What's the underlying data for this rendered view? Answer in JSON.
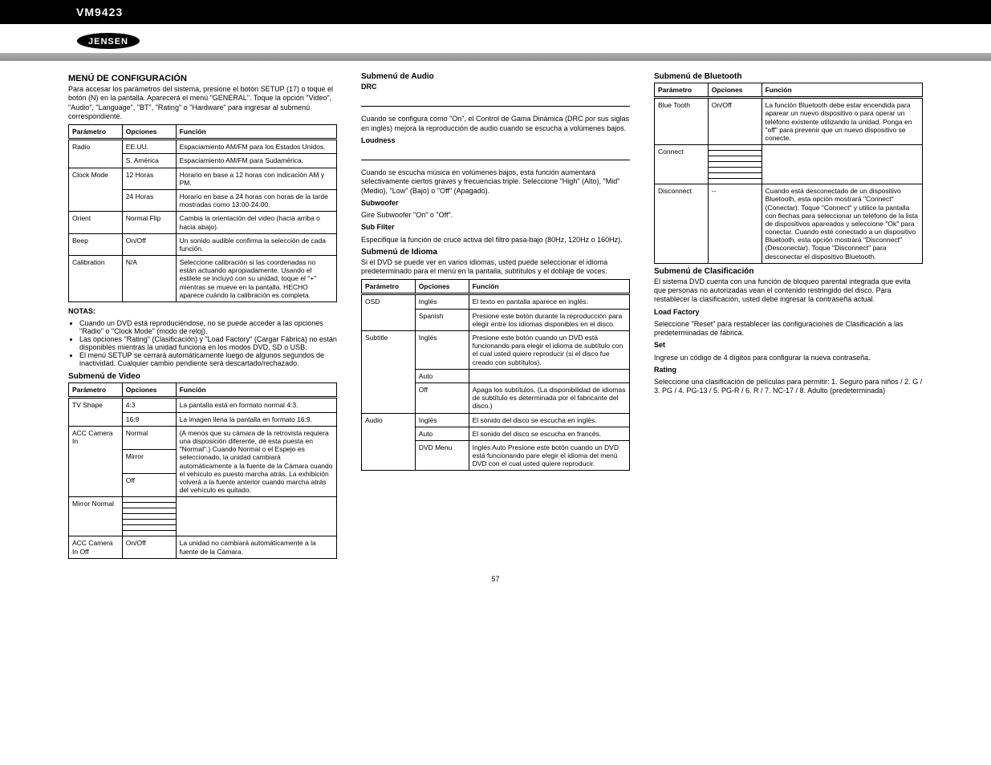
{
  "header": {
    "model": "VM9423",
    "brand": "JENSEN"
  },
  "col1": {
    "title": "MENÚ DE CONFIGURACIÓN",
    "intro": "Para accesar los parámetros del sistema, presione el botón SETUP (17) o toque el botón (N) en la pantalla. Aparecerá el menú \"GENERAL\". Toque la opción \"Video\", \"Audio\", \"Language\", \"BT\", \"Rating\" o \"Hardware\" para ingresar al submenú correspondiente.",
    "t1": {
      "h": [
        "Parámetro",
        "Opciones",
        "Función"
      ],
      "rows": [
        {
          "a": "Radio",
          "sub": [
            {
              "b": "EE.UU.",
              "c": "Espaciamiento AM/FM para los Estados Unidos."
            },
            {
              "b": "S. América",
              "c": "Espaciamiento AM/FM para Sudamérica."
            }
          ]
        },
        {
          "a": "Clock Mode",
          "sub": [
            {
              "b": "12 Horas",
              "c": "Horario en base a 12 horas con indicación AM y PM."
            },
            {
              "b": "24 Horas",
              "c": "Horario en base a 24 horas con horas de la tarde mostradas como 13:00-24:00."
            }
          ]
        },
        {
          "a": "Orient",
          "sub": [
            {
              "b": "Normal Flip",
              "c": "Cambia la orientación del video (hacia arriba o hacia abajo)."
            }
          ]
        },
        {
          "a": "Beep",
          "sub": [
            {
              "b": "On/Off",
              "c": "Un sonido audible confirma la selección de cada función."
            }
          ]
        },
        {
          "a": "Calibration",
          "sub": [
            {
              "b": "N/A",
              "c": "Seleccione calibración si las coordenadas no están actuando apropiadamente. Usando el estilete se incluyó con su unidad, toque el \"+\" mientras se mueve en la pantalla. HECHO aparece cuándo la calibración es completa."
            }
          ]
        }
      ]
    },
    "notes_title": "NOTAS:",
    "notes": [
      "Cuando un DVD está reproduciéndose, no se puede acceder a las opciones \"Radio\" o \"Clock Mode\" (modo de reloj).",
      "Las opciones \"Rating\" (Clasificación) y \"Load Factory\" (Cargar Fábrica) no están disponibles mientras la unidad funciona en los modos DVD, SD o USB.",
      "El menú SETUP se cerrará automáticamente luego de algunos segundos de inactividad. Cualquier cambio pendiente será descartado/rechazado."
    ],
    "video_title": "Submenú de Video",
    "t2": {
      "h": [
        "Parámetro",
        "Opciones",
        "Función"
      ],
      "rows": [
        {
          "a": "TV Shape",
          "sub": [
            {
              "b": "4:3",
              "c": "La pantalla está en formato normal 4:3."
            },
            {
              "b": "16:9",
              "c": "La imagen llena la pantalla en formato 16:9."
            }
          ]
        },
        {
          "a": "ACC Camera In",
          "sub": [
            {
              "b": "Normal",
              "c": "(A menos que su cámara de la retrovista requiera una disposición diferente, dé esta puesta en \"Normal\".) Cuando Normal o el Espejo es seleccionado, la unidad cambiará automáticamente a la fuente de la Cámara cuando el vehículo es puesto marcha atrás. La exhibición volverá a la fuente anterior cuando marcha atrás del vehículo es quitado."
            },
            {
              "b": "Mirror",
              "c": ""
            },
            {
              "b": "Off",
              "c": ""
            }
          ]
        },
        {
          "a": "Mirror Normal",
          "sub": [
            {
              "b": "",
              "c": ""
            },
            {
              "b": "",
              "c": ""
            },
            {
              "b": "",
              "c": ""
            },
            {
              "b": "",
              "c": ""
            },
            {
              "b": "",
              "c": ""
            },
            {
              "b": "",
              "c": ""
            },
            {
              "b": "",
              "c": ""
            }
          ]
        },
        {
          "a": "ACC Camera In Off",
          "sub": [
            {
              "b": "On/Off",
              "c": "La unidad no cambiará automáticamente a la fuente de la Cámara."
            }
          ]
        }
      ]
    }
  },
  "col2": {
    "audio_title": "Submenú de Audio",
    "drc_t": "DRC",
    "drc": "Cuando se configura como \"On\", el Control de Gama Dinámica (DRC por sus siglas en inglés) mejora la reproducción de audio cuando se escucha a volúmenes bajos.",
    "loud_t": "Loudness",
    "loud": "Cuando se escucha música en volúmenes bajos, esta función aumentará selectivamente ciertos graves y frecuencias triple. Seleccione \"High\" (Alto), \"Mid\" (Medio), \"Low\" (Bajo) o \"Off\" (Apagado).",
    "sub_t": "Subwoofer",
    "sub1": "Gire Subwoofer \"On\" o \"Off\".",
    "subfilt_t": "Sub Filter",
    "subfilt": "Especifique la función de cruce activa del filtro pasa-bajo (80Hz, 120Hz o 160Hz).",
    "lang_title": "Submenú de Idioma",
    "lang_intro": "Si el DVD se puede ver en varios idiomas, usted puede seleccionar el idioma predeterminado para el menú en la pantalla, subtítulos y el doblaje de voces.",
    "t3": {
      "h": [
        "Parámetro",
        "Opciones",
        "Función"
      ],
      "rows": [
        {
          "a": "OSD",
          "sub": [
            {
              "b": "Inglés",
              "c": "El texto en pantalla aparece en inglés."
            },
            {
              "b": "Spanish",
              "c": "Presione este botón durante la reproducción para elegir entre los idiomas disponibles en el disco."
            }
          ]
        },
        {
          "a": "Subtitle",
          "sub": [
            {
              "b": "Inglés",
              "c": "Presione este botón cuando un DVD está funcionando para elegir el idioma de subtítulo con el cual usted quiere reproducir (si el disco fue creado con subtítulos)."
            },
            {
              "b": "Auto",
              "c": ""
            },
            {
              "b": "Off",
              "c": "Apaga los subtítulos. (La disponibilidad de idiomas de subtítulo es determinada por el fabricante del disco.)"
            }
          ]
        },
        {
          "a": "Audio",
          "sub": [
            {
              "b": "Inglés",
              "c": "El sonido del disco se escucha en inglés."
            },
            {
              "b": "Auto",
              "c": "El sonido del disco se escucha en francés."
            },
            {
              "b": "DVD Menu",
              "c": "Inglés Auto Presione este botón cuando un DVD está funcionando pare elegir el idioma del menú DVD con el cual usted quiere reproducir."
            }
          ]
        }
      ]
    }
  },
  "col3": {
    "bt_title": "Submenú de Bluetooth",
    "t4": {
      "h": [
        "Parámetro",
        "Opciones",
        "Función"
      ],
      "rows": [
        {
          "a": "Blue Tooth",
          "sub": [
            {
              "b": "On/Off",
              "c": "La función Bluetooth debe estar encendida para aparear un nuevo dispositivo o para operar un teléfono existente utilizando la unidad. Ponga en \"off\" para prevenir que un nuevo dispositivo se conecte."
            }
          ]
        },
        {
          "a": "Connect",
          "sub": [
            {
              "b": "",
              "c": ""
            },
            {
              "b": "",
              "c": ""
            },
            {
              "b": "",
              "c": ""
            },
            {
              "b": "",
              "c": ""
            },
            {
              "b": "",
              "c": ""
            },
            {
              "b": "",
              "c": ""
            },
            {
              "b": "",
              "c": ""
            }
          ]
        },
        {
          "a": "Disconnect",
          "sub": [
            {
              "b": "--",
              "c": "Cuando está desconectado de un dispositivo Bluetooth, esta opción mostrará \"Connect\" (Conectar). Toque \"Connect\" y utilice la pantalla con flechas para seleccionar un teléfono de la lista de dispositivos apareados y seleccione \"Ok\" para conectar. Cuando esté conectado a un dispositivo Bluetooth, esta opción mostrará \"Disconnect\" (Desconectar). Toque \"Disconnect\" para desconectar el dispositivo Bluetooth."
            }
          ]
        }
      ]
    },
    "rating_title": "Submenú de Clasificación",
    "rating_intro": "El sistema DVD cuenta con una función de bloqueo parental integrada que evita que personas no autorizadas vean el contenido restringido del disco. Para restablecer la clasificación, usted debe ingresar la contraseña actual.",
    "load_t": "Load Factory",
    "load": "Seleccione \"Reset\" para restablecer las configuraciones de Clasificación a las predeterminadas de fábrica.",
    "set_t": "Set",
    "set": "Ingrese un código de 4 dígitos para configurar la nueva contraseña.",
    "rating_t": "Rating",
    "rating": "Seleccione una clasificación de películas para permitir: 1. Seguro para niños / 2. G / 3. PG / 4. PG-13 / 5. PG-R / 6. R / 7. NC-17 / 8. Adulto (predeterminada)"
  },
  "page_number": "57"
}
